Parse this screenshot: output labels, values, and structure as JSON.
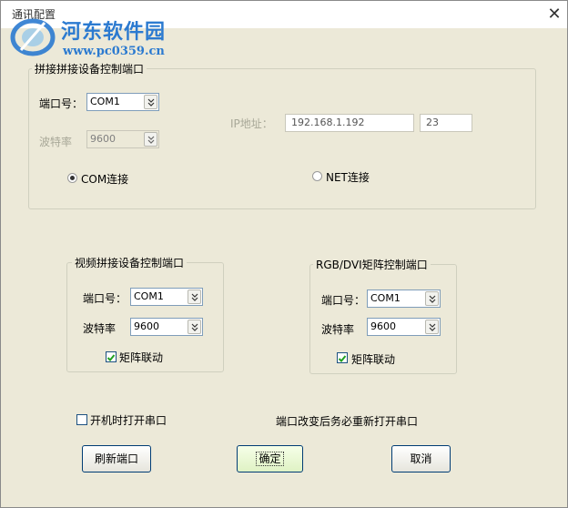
{
  "window": {
    "title": "通讯配置",
    "close_glyph": "✕"
  },
  "watermark": {
    "brand": "河东软件园",
    "url": "www.pc0359.cn"
  },
  "main_group": {
    "title": "拼接拼接设备控制端口",
    "port_label": "端口号：",
    "port_value": "COM1",
    "baud_label": "波特率",
    "baud_value": "9600",
    "ip_label": "IP地址：",
    "ip_value": "192.168.1.192",
    "ip_port_value": "23",
    "com_radio_label": "COM连接",
    "net_radio_label": "NET连接",
    "selected_connection": "COM连接"
  },
  "video_group": {
    "title": "视频拼接设备控制端口",
    "port_label": "端口号：",
    "port_value": "COM1",
    "baud_label": "波特率",
    "baud_value": "9600",
    "matrix_link_label": "矩阵联动",
    "matrix_link_checked": true
  },
  "rgb_group": {
    "title": "RGB/DVI矩阵控制端口",
    "port_label": "端口号：",
    "port_value": "COM1",
    "baud_label": "波特率",
    "baud_value": "9600",
    "matrix_link_label": "矩阵联动",
    "matrix_link_checked": true
  },
  "startup": {
    "label": "开机时打开串口",
    "checked": false
  },
  "notice": "端口改变后务必重新打开串口",
  "buttons": {
    "refresh": "刷新端口",
    "ok": "确定",
    "cancel": "取消"
  },
  "colors": {
    "accent": "#2b7ad0",
    "dialog_bg": "#ece9d8",
    "ok_button_tint": "#dff2c4"
  }
}
